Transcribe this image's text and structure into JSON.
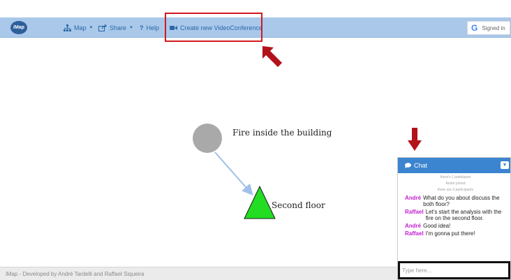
{
  "app": {
    "logo_text": "iMap",
    "footer": "iMap - Developed by André Tardelli and Raffael Siqueira"
  },
  "toolbar": {
    "map_label": "Map",
    "share_label": "Share",
    "help_label": "Help",
    "videoconference_label": "Create new VideoConference"
  },
  "auth": {
    "google_label": "G",
    "signed_in_label": "Signed in"
  },
  "graph": {
    "nodes": [
      {
        "label": "Fire inside the building",
        "shape": "circle",
        "color": "#a9a9a9"
      },
      {
        "label": "Second floor",
        "shape": "triangle",
        "color": "#22dd22"
      }
    ],
    "edge_color": "#9fc0ea"
  },
  "chat": {
    "title": "Chat",
    "system_messages": [
      "there's 1 participant",
      "André joined",
      "there are 2 participants"
    ],
    "messages": [
      {
        "author": "André",
        "text": "What do you about discuss the both floor?"
      },
      {
        "author": "Raffael",
        "text": "Let's start the analysis with the fire on the second floor."
      },
      {
        "author": "André",
        "text": "Good idea!"
      },
      {
        "author": "Raffael",
        "text": "I'm gonna put there!"
      }
    ],
    "input_placeholder": "Type here..."
  },
  "colors": {
    "navbar": "#a9c8ea",
    "nav_link": "#2b67a8",
    "highlight": "#d0191e",
    "chat_header": "#3b84cf",
    "chat_author": "#c21fd0",
    "annotation_arrow": "#b3121a"
  },
  "icons": {
    "logo": "imap-logo-icon",
    "map": "sitemap-icon",
    "share": "share-icon",
    "help": "question-icon",
    "video": "video-camera-icon",
    "google": "google-icon",
    "chat": "speech-bubble-icon",
    "chat_toggle": "chevron-down-icon"
  }
}
